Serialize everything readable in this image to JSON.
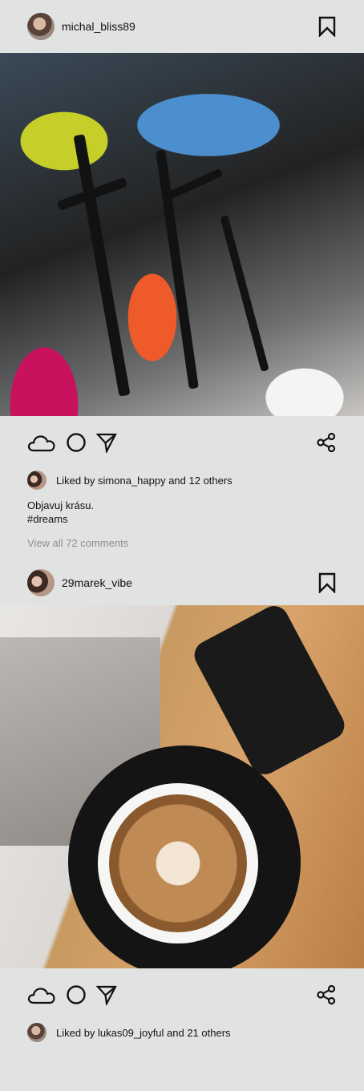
{
  "posts": [
    {
      "username": "michal_bliss89",
      "liked_by_user": "simona_happy",
      "likes_text": "Liked by simona_happy and 12 others",
      "caption_line1": "Objavuj krásu.",
      "caption_line2": "#dreams",
      "comments_link": "View all 72 comments",
      "icons": {
        "bookmark": "bookmark-icon",
        "like": "cloud-icon",
        "comment": "circle-icon",
        "share_send": "send-icon",
        "share": "share-icon"
      }
    },
    {
      "username": "29marek_vibe",
      "liked_by_user": "lukas09_joyful",
      "likes_text": "Liked by lukas09_joyful and 21 others",
      "icons": {
        "bookmark": "bookmark-icon",
        "like": "cloud-icon",
        "comment": "circle-icon",
        "share_send": "send-icon",
        "share": "share-icon"
      }
    }
  ],
  "colors": {
    "background": "#e1e3e2",
    "text": "#111111",
    "muted": "#8e9090"
  }
}
